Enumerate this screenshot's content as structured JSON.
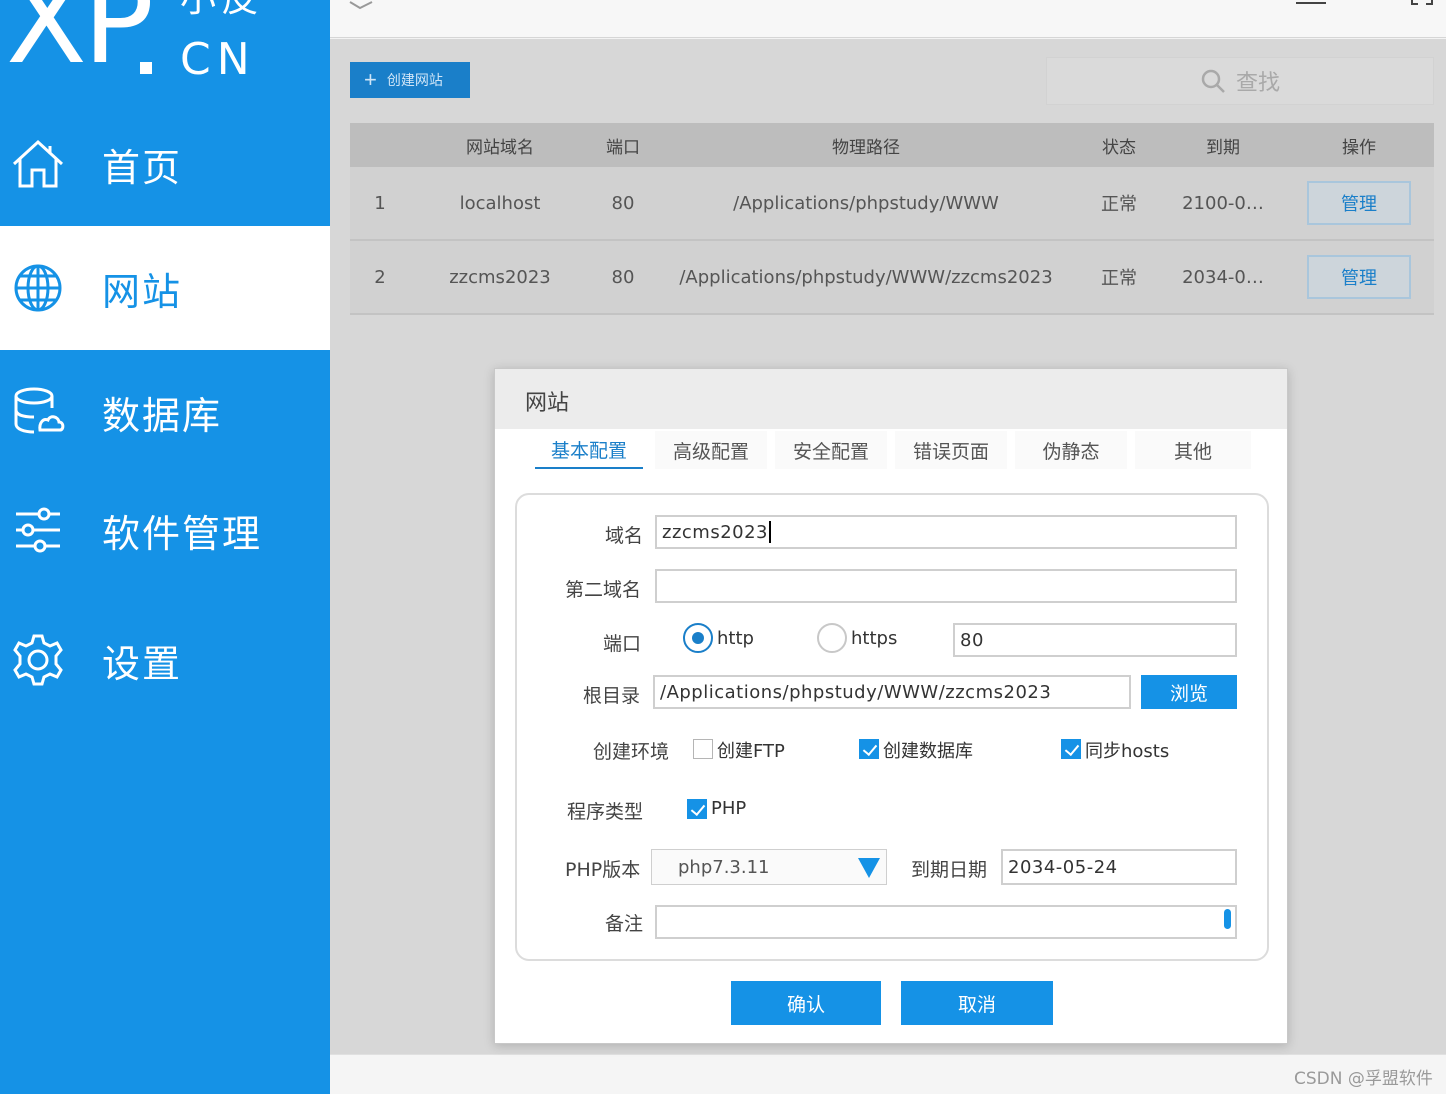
{
  "brand": {
    "logo_main": "XP",
    "logo_suffix": "CN",
    "logo_sub": "小皮"
  },
  "colors": {
    "accent": "#1592e6",
    "sidebar": "#1592e6",
    "dim": "#d7d7d7"
  },
  "sidebar": {
    "items": [
      {
        "label": "首页",
        "icon": "home-icon"
      },
      {
        "label": "网站",
        "icon": "globe-icon"
      },
      {
        "label": "数据库",
        "icon": "database-icon"
      },
      {
        "label": "软件管理",
        "icon": "sliders-icon"
      },
      {
        "label": "设置",
        "icon": "gear-icon"
      }
    ],
    "active": "网站"
  },
  "toolbar": {
    "create_label": "创建网站",
    "search_label": "查找"
  },
  "table": {
    "headers": [
      "网站域名",
      "端口",
      "物理路径",
      "状态",
      "到期",
      "操作"
    ],
    "rows": [
      {
        "index": "1",
        "domain": "localhost",
        "port": "80",
        "path": "/Applications/phpstudy/WWW",
        "status": "正常",
        "expires": "2100-0…",
        "action": "管理"
      },
      {
        "index": "2",
        "domain": "zzcms2023",
        "port": "80",
        "path": "/Applications/phpstudy/WWW/zzcms2023",
        "status": "正常",
        "expires": "2034-0…",
        "action": "管理"
      }
    ]
  },
  "dialog": {
    "title": "网站",
    "tabs": [
      "基本配置",
      "高级配置",
      "安全配置",
      "错误页面",
      "伪静态",
      "其他"
    ],
    "active_tab": "基本配置",
    "labels": {
      "domain": "域名",
      "second_domain": "第二域名",
      "port": "端口",
      "root": "根目录",
      "env": "创建环境",
      "program": "程序类型",
      "php_version": "PHP版本",
      "expire_date": "到期日期",
      "remark": "备注"
    },
    "values": {
      "domain": "zzcms2023",
      "second_domain": "",
      "port": "80",
      "root": "/Applications/phpstudy/WWW/zzcms2023",
      "php_version": "php7.3.11",
      "expire_date": "2034-05-24",
      "remark": ""
    },
    "protocols": [
      {
        "label": "http",
        "selected": true
      },
      {
        "label": "https",
        "selected": false
      }
    ],
    "browse_label": "浏览",
    "env_options": [
      {
        "label": "创建FTP",
        "checked": false
      },
      {
        "label": "创建数据库",
        "checked": true
      },
      {
        "label": "同步hosts",
        "checked": true
      }
    ],
    "program_options": [
      {
        "label": "PHP",
        "checked": true
      }
    ],
    "confirm_label": "确认",
    "cancel_label": "取消"
  },
  "watermark": "CSDN @孚盟软件"
}
